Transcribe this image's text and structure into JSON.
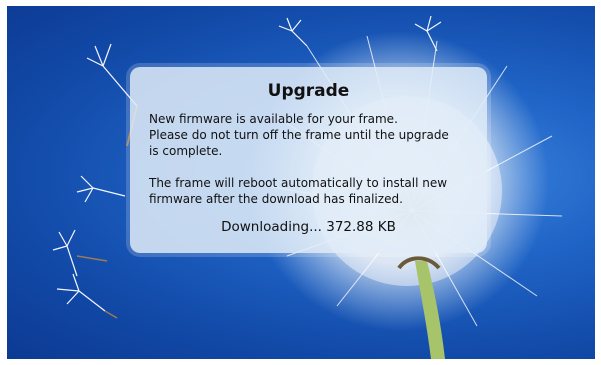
{
  "dialog": {
    "title": "Upgrade",
    "message_line_1": "New firmware is available for your frame.",
    "message_line_2": "Please do not turn off the frame until the upgrade",
    "message_line_3": "is complete.",
    "message_line_4": "The frame will reboot automatically to install new",
    "message_line_5": "firmware after the download has finalized.",
    "status": "Downloading... 372.88 KB"
  },
  "colors": {
    "sky": "#1f64c6",
    "dialog_background": "#e1ecf8",
    "dandelion_stem": "#a8c46a"
  }
}
